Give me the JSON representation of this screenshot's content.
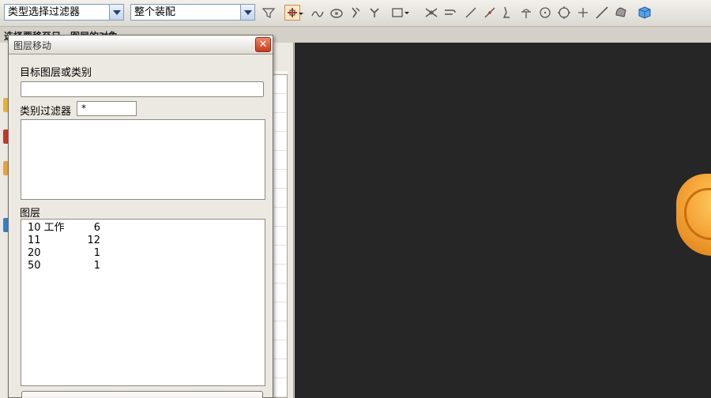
{
  "toolbar": {
    "filter_combo": "类型选择过滤器",
    "scope_combo": "整个装配",
    "icons": [
      "filter-icon",
      "snap-point-icon",
      "curve-icon",
      "sketch-icon",
      "rotate-icon",
      "select-rect-icon",
      "intersection-icon",
      "line-icon",
      "spline-icon",
      "arc-icon",
      "circle-icon",
      "sphere-icon",
      "plus-icon",
      "diagonal-line-icon",
      "shaded-view-icon",
      "cube-icon"
    ]
  },
  "prompt": "选择要移至另一图层的对象",
  "dialog": {
    "title": "图层移动",
    "close_label": "✕",
    "target_label": "目标图层或类别",
    "target_value": "",
    "filter_label": "类别过滤器",
    "filter_value": "*",
    "layers_label": "图层",
    "layers": [
      {
        "name": "10 工作",
        "count": "6"
      },
      {
        "name": "11",
        "count": "12"
      },
      {
        "name": "20",
        "count": "1"
      },
      {
        "name": "50",
        "count": "1"
      }
    ]
  },
  "colors": {
    "viewport_bg": "#262626",
    "part_orange": "#f6a73a",
    "close_red": "#c93b1b"
  }
}
